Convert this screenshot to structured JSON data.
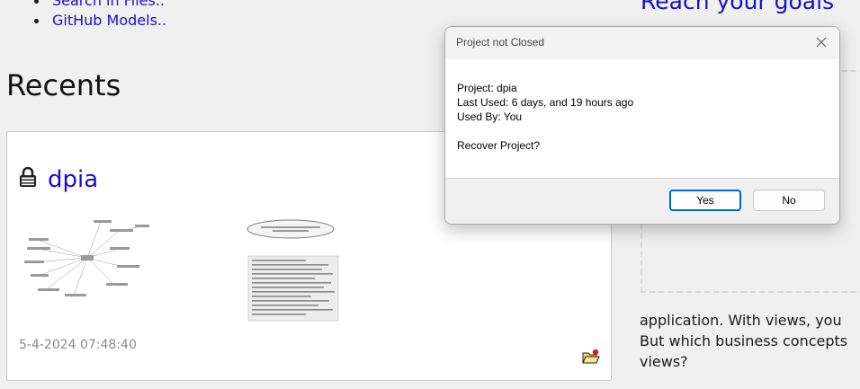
{
  "top_links": [
    "Search in Files..",
    "GitHub Models.."
  ],
  "right_heading": "Reach your goals",
  "recents": {
    "title": "Recents",
    "card": {
      "name": "dpia",
      "date": "5-4-2024 07:48:40"
    }
  },
  "right_text": {
    "line1": "application. With views, you",
    "line2": "But which business concepts",
    "line3": "views?"
  },
  "dialog": {
    "title": "Project not Closed",
    "project_line": "Project: dpia",
    "last_used_line": "Last Used: 6 days, and 19 hours ago",
    "used_by_line": "Used By: You",
    "question": "Recover Project?",
    "yes_label": "Yes",
    "no_label": "No"
  },
  "icons": {
    "lock": "lock-icon",
    "folder": "folder-open-icon",
    "close": "close-icon"
  },
  "colors": {
    "link": "#1a0dcc",
    "primary_button_border": "#0067c0",
    "background": "#f0f0f0"
  }
}
